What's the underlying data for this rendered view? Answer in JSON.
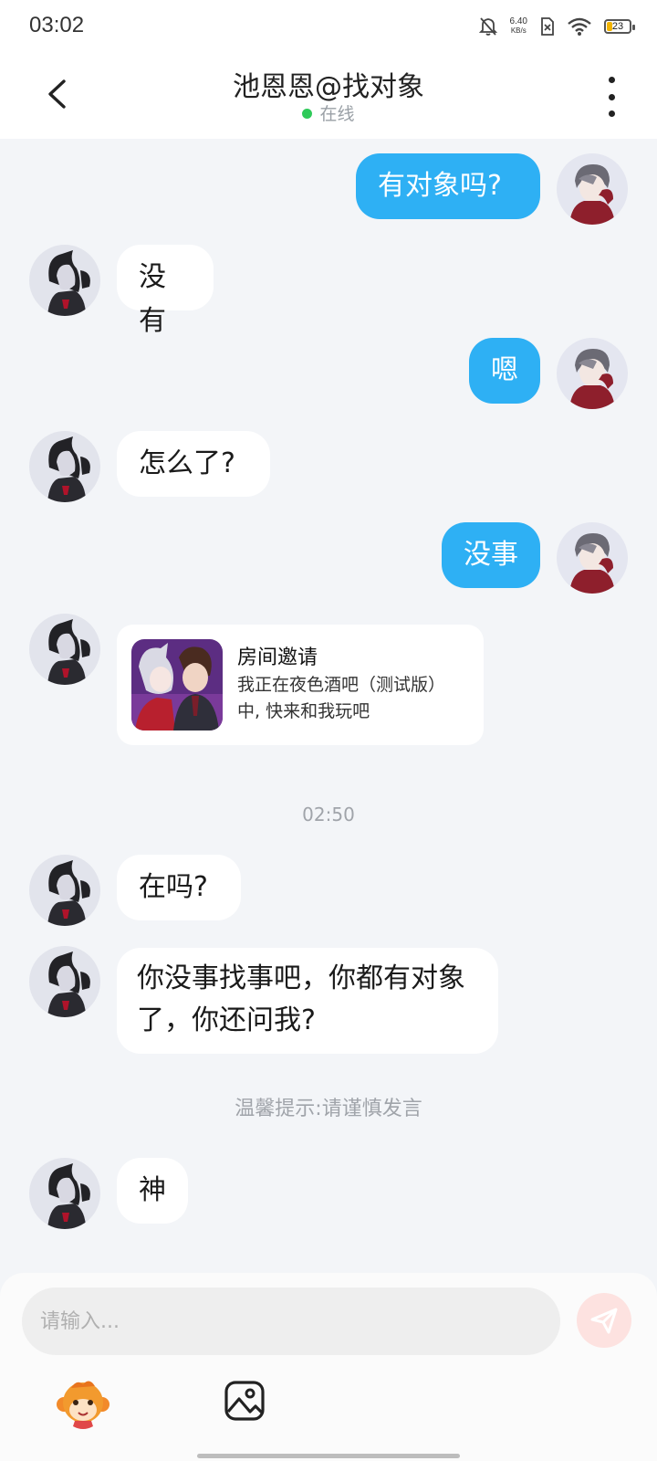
{
  "status_bar": {
    "time": "03:02",
    "net_speed_value": "6.40",
    "net_speed_unit": "KB/s",
    "battery": "23",
    "icons": [
      "bell-off-icon",
      "sim-error-icon",
      "wifi-icon",
      "battery-icon"
    ]
  },
  "header": {
    "title": "池恩恩@找对象",
    "status": "在线",
    "status_color": "#2fca5a"
  },
  "messages": [
    {
      "side": "right",
      "text": "有对象吗?"
    },
    {
      "side": "left",
      "text": "没有"
    },
    {
      "side": "right",
      "text": "嗯"
    },
    {
      "side": "left",
      "text": "怎么了?"
    },
    {
      "side": "right",
      "text": "没事"
    },
    {
      "side": "left",
      "type": "card",
      "title": "房间邀请",
      "desc": "我正在夜色酒吧（测试版）中, 快来和我玩吧"
    },
    {
      "type": "timestamp",
      "text": "02:50"
    },
    {
      "side": "left",
      "text": "在吗?"
    },
    {
      "side": "left",
      "text": "你没事找事吧，你都有对象了，你还问我?"
    },
    {
      "type": "tip",
      "text": "温馨提示:请谨慎发言"
    },
    {
      "side": "left",
      "text": "神"
    }
  ],
  "composer": {
    "placeholder": "请输入...",
    "send_icon": "send-icon",
    "emoji_icon": "monkey-emoji-icon",
    "image_icon": "image-icon"
  },
  "colors": {
    "outgoing_bubble": "#2eb0f4",
    "incoming_bubble": "#ffffff",
    "background": "#f3f5f8"
  }
}
